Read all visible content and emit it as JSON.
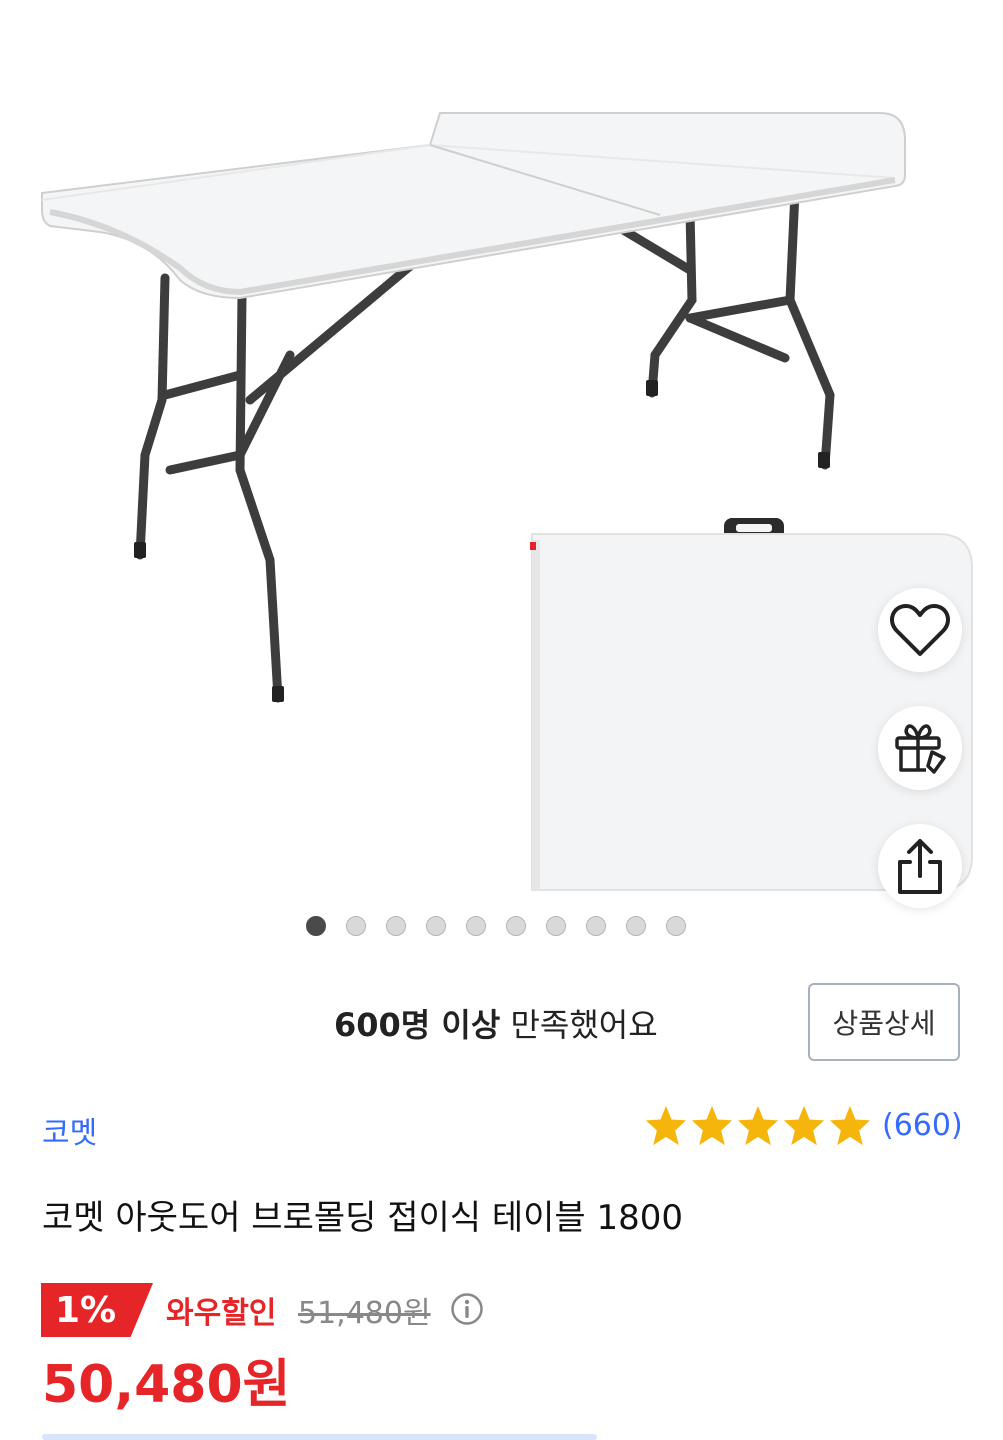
{
  "gallery": {
    "image_count": 10,
    "active_index": 0,
    "image_alt": "folding table"
  },
  "actions": {
    "favorite_icon": "heart-icon",
    "gift_icon": "gift-icon",
    "share_icon": "share-icon"
  },
  "satisfaction": {
    "bold": "600명 이상",
    "rest": " 만족했어요"
  },
  "detail_button": "상품상세",
  "brand": "코멧",
  "rating": {
    "stars": 5,
    "count_text": "(660)",
    "star_color": "#f5b50a"
  },
  "product_title": "코멧 아웃도어 브로몰딩 접이식 테이블 1800",
  "price": {
    "discount_rate": "1%",
    "wow_label": "와우할인",
    "original": "51,480원",
    "final": "50,480원",
    "accent_color": "#e52528"
  }
}
